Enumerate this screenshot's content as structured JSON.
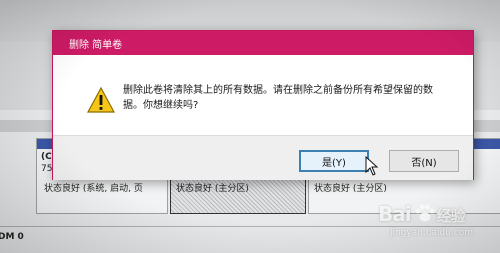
{
  "dialog": {
    "title": "删除 简单卷",
    "message": "删除此卷将清除其上的所有数据。请在删除之前备份所有希望保留的数据。你想继续吗?",
    "yes_label": "是(Y)",
    "no_label": "否(N)",
    "icon": "warning-icon"
  },
  "background": {
    "partitions": [
      {
        "name": "(C:",
        "size": "75.0",
        "status": "状态良好 (系统, 启动, 页"
      },
      {
        "status": "状态良好 (主分区)"
      },
      {
        "status": "状态良好 (主分区)"
      }
    ],
    "disk_label": "DM 0"
  },
  "watermark": {
    "brand": "Bai",
    "brand_tail": "经验",
    "url": "jingyan.baidu.com"
  },
  "colors": {
    "title_bar": "#cd1b66",
    "partition_header": "#3a57a6",
    "default_button_border": "#3c7fb1"
  }
}
